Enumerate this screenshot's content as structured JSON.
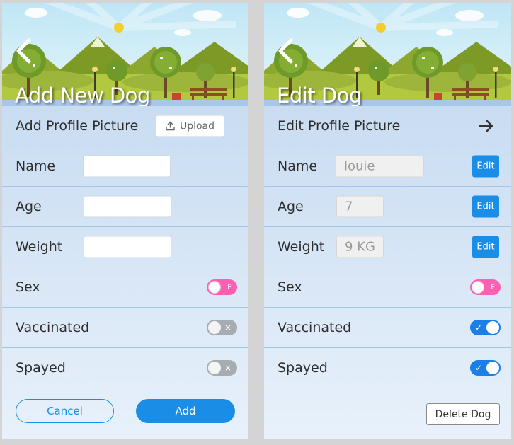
{
  "add_form": {
    "title": "Add New Dog",
    "profile_picture_label": "Add Profile Picture",
    "upload_label": "Upload",
    "fields": {
      "name": {
        "label": "Name",
        "value": ""
      },
      "age": {
        "label": "Age",
        "value": ""
      },
      "weight": {
        "label": "Weight",
        "value": ""
      }
    },
    "toggles": {
      "sex": {
        "label": "Sex",
        "state": "F",
        "tag": "F"
      },
      "vaccinated": {
        "label": "Vaccinated",
        "state": "off",
        "tag": "×"
      },
      "spayed": {
        "label": "Spayed",
        "state": "off",
        "tag": "×"
      }
    },
    "cancel_label": "Cancel",
    "add_label": "Add"
  },
  "edit_form": {
    "title": "Edit Dog",
    "profile_picture_label": "Edit Profile Picture",
    "fields": {
      "name": {
        "label": "Name",
        "value": "louie",
        "edit_label": "Edit"
      },
      "age": {
        "label": "Age",
        "value": "7",
        "edit_label": "Edit"
      },
      "weight": {
        "label": "Weight",
        "value": "9 KG",
        "edit_label": "Edit"
      }
    },
    "toggles": {
      "sex": {
        "label": "Sex",
        "state": "F",
        "tag": "F"
      },
      "vaccinated": {
        "label": "Vaccinated",
        "state": "on",
        "tag": "✓"
      },
      "spayed": {
        "label": "Spayed",
        "state": "on",
        "tag": "✓"
      }
    },
    "delete_label": "Delete Dog"
  },
  "colors": {
    "accent": "#1a8ee6",
    "toggle_on": "#1a7fe6",
    "toggle_female": "#ff5fb0",
    "toggle_off": "#a7acb2",
    "row_divider": "#9fc7ea"
  },
  "icons": {
    "back": "back-chevron-icon",
    "upload": "upload-icon",
    "arrow": "arrow-right-icon"
  }
}
